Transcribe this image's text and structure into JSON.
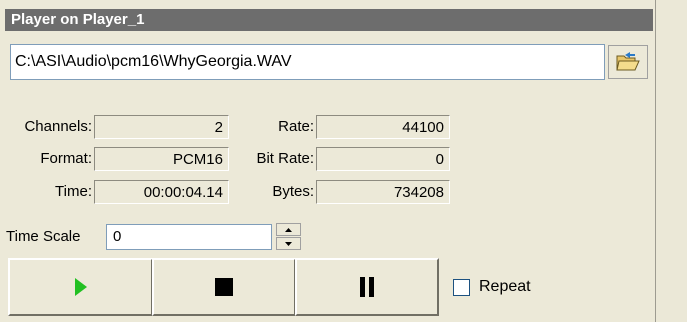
{
  "window": {
    "title": "Player on Player_1"
  },
  "file": {
    "path": "C:\\ASI\\Audio\\pcm16\\WhyGeorgia.WAV",
    "browse_icon": "folder-open-icon"
  },
  "info": {
    "channels_label": "Channels:",
    "channels_value": "2",
    "format_label": "Format:",
    "format_value": "PCM16",
    "time_label": "Time:",
    "time_value": "00:00:04.14",
    "rate_label": "Rate:",
    "rate_value": "44100",
    "bitrate_label": "Bit Rate:",
    "bitrate_value": "0",
    "bytes_label": "Bytes:",
    "bytes_value": "734208"
  },
  "timescale": {
    "label": "Time Scale",
    "value": "0"
  },
  "controls": {
    "play_icon": "play-icon",
    "stop_icon": "stop-icon",
    "pause_icon": "pause-icon",
    "play_color": "#22c022"
  },
  "repeat": {
    "label": "Repeat",
    "checked": false
  }
}
